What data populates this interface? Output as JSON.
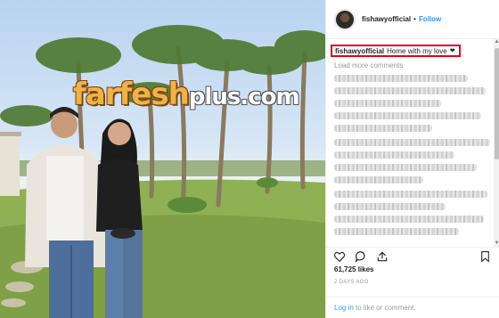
{
  "photo": {
    "watermark_main": "farfesh",
    "watermark_suffix": "plus.com"
  },
  "header": {
    "username": "fishawyofficial",
    "separator": "•",
    "follow_label": "Follow"
  },
  "caption": {
    "username": "fishawyofficial",
    "text": "Home with my love",
    "heart": "❤"
  },
  "comments": {
    "load_more_label": "Load more comments"
  },
  "actions": {
    "like_icon": "heart-outline-icon",
    "comment_icon": "comment-bubble-icon",
    "share_icon": "share-arrow-icon",
    "save_icon": "bookmark-icon"
  },
  "likes": {
    "count_text": "61,725 likes"
  },
  "timestamp": {
    "text": "2 DAYS AGO"
  },
  "login": {
    "link_text": "Log in",
    "rest_text": " to like or comment."
  },
  "colors": {
    "link_blue": "#3897f0",
    "highlight_red": "#e0001a",
    "text_dark": "#262626",
    "text_gray": "#999999"
  }
}
